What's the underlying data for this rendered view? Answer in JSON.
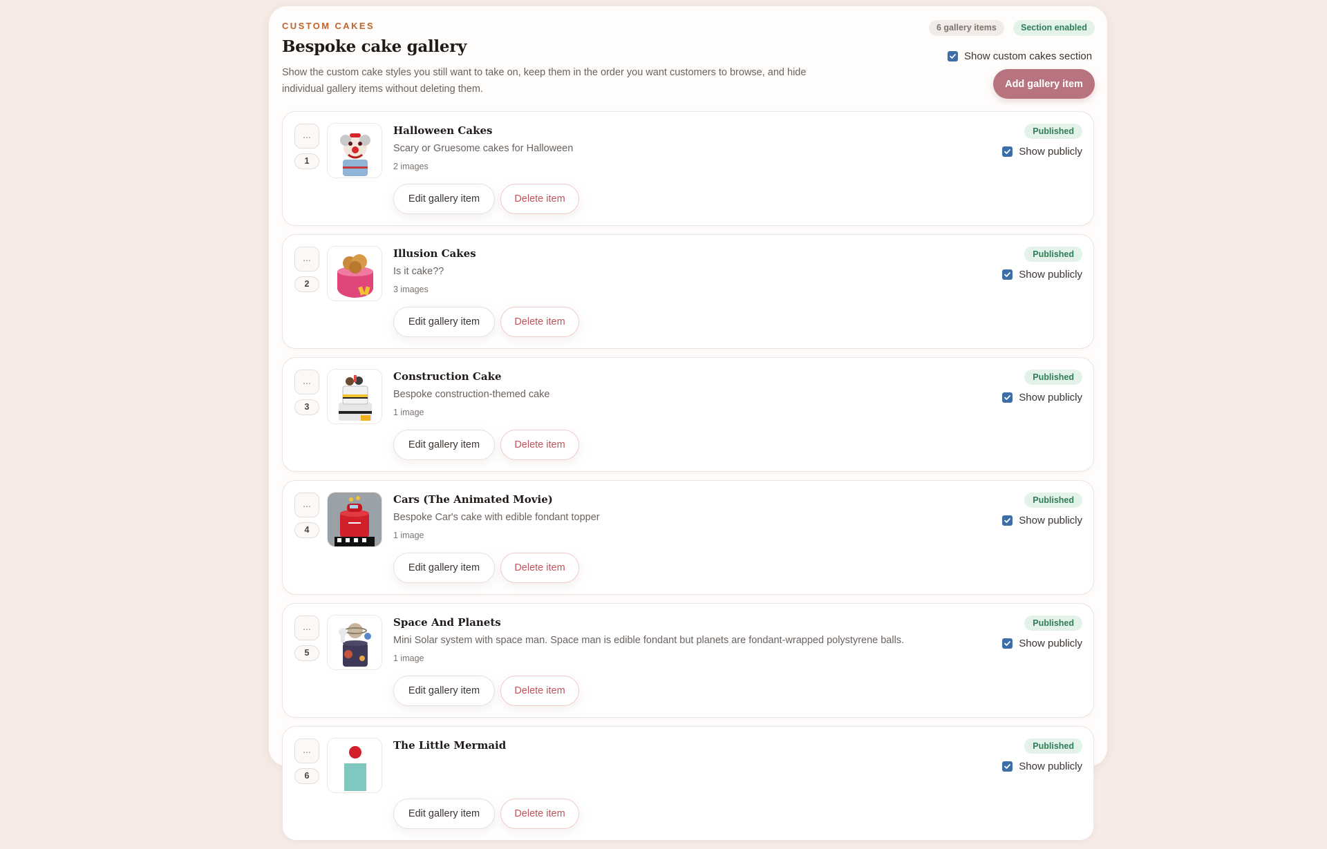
{
  "header": {
    "eyebrow": "CUSTOM CAKES",
    "title": "Bespoke cake gallery",
    "description": "Show the custom cake styles you still want to take on, keep them in the order you want customers to browse, and hide individual gallery items without deleting them.",
    "count_badge": "6 gallery items",
    "status_badge": "Section enabled",
    "show_section_label": "Show custom cakes section",
    "show_section_checked": true,
    "add_button_label": "Add gallery item"
  },
  "colors": {
    "accent": "#b7747e",
    "eyebrow": "#c0632e",
    "published_bg": "#e3f3ea",
    "published_text": "#2e7d55",
    "checkbox": "#3d6ea8",
    "delete_text": "#c2515a"
  },
  "items": [
    {
      "drag_label": "...",
      "position": "1",
      "title": "Halloween Cakes",
      "description": "Scary or Gruesome cakes for Halloween",
      "image_count": "2 images",
      "status": "Published",
      "public_label": "Show publicly",
      "public_checked": true,
      "edit_label": "Edit gallery item",
      "delete_label": "Delete item",
      "thumb_icon": "clown-cake-image"
    },
    {
      "drag_label": "...",
      "position": "2",
      "title": "Illusion Cakes",
      "description": "Is it cake??",
      "image_count": "3 images",
      "status": "Published",
      "public_label": "Show publicly",
      "public_checked": true,
      "edit_label": "Edit gallery item",
      "delete_label": "Delete item",
      "thumb_icon": "chicken-bucket-cake-image"
    },
    {
      "drag_label": "...",
      "position": "3",
      "title": "Construction Cake",
      "description": "Bespoke construction-themed cake",
      "image_count": "1 image",
      "status": "Published",
      "public_label": "Show publicly",
      "public_checked": true,
      "edit_label": "Edit gallery item",
      "delete_label": "Delete item",
      "thumb_icon": "construction-cake-image"
    },
    {
      "drag_label": "...",
      "position": "4",
      "title": "Cars (The Animated Movie)",
      "description": "Bespoke Car's cake with edible fondant topper",
      "image_count": "1 image",
      "status": "Published",
      "public_label": "Show publicly",
      "public_checked": true,
      "edit_label": "Edit gallery item",
      "delete_label": "Delete item",
      "thumb_icon": "race-car-cake-image"
    },
    {
      "drag_label": "...",
      "position": "5",
      "title": "Space And Planets",
      "description": "Mini Solar system with space man. Space man is edible fondant but planets are fondant-wrapped polystyrene balls.",
      "image_count": "1 image",
      "status": "Published",
      "public_label": "Show publicly",
      "public_checked": true,
      "edit_label": "Edit gallery item",
      "delete_label": "Delete item",
      "thumb_icon": "planets-cake-image"
    },
    {
      "drag_label": "...",
      "position": "6",
      "title": "The Little Mermaid",
      "description": "",
      "image_count": "",
      "status": "Published",
      "public_label": "Show publicly",
      "public_checked": true,
      "edit_label": "Edit gallery item",
      "delete_label": "Delete item",
      "thumb_icon": "mermaid-cake-image"
    }
  ]
}
